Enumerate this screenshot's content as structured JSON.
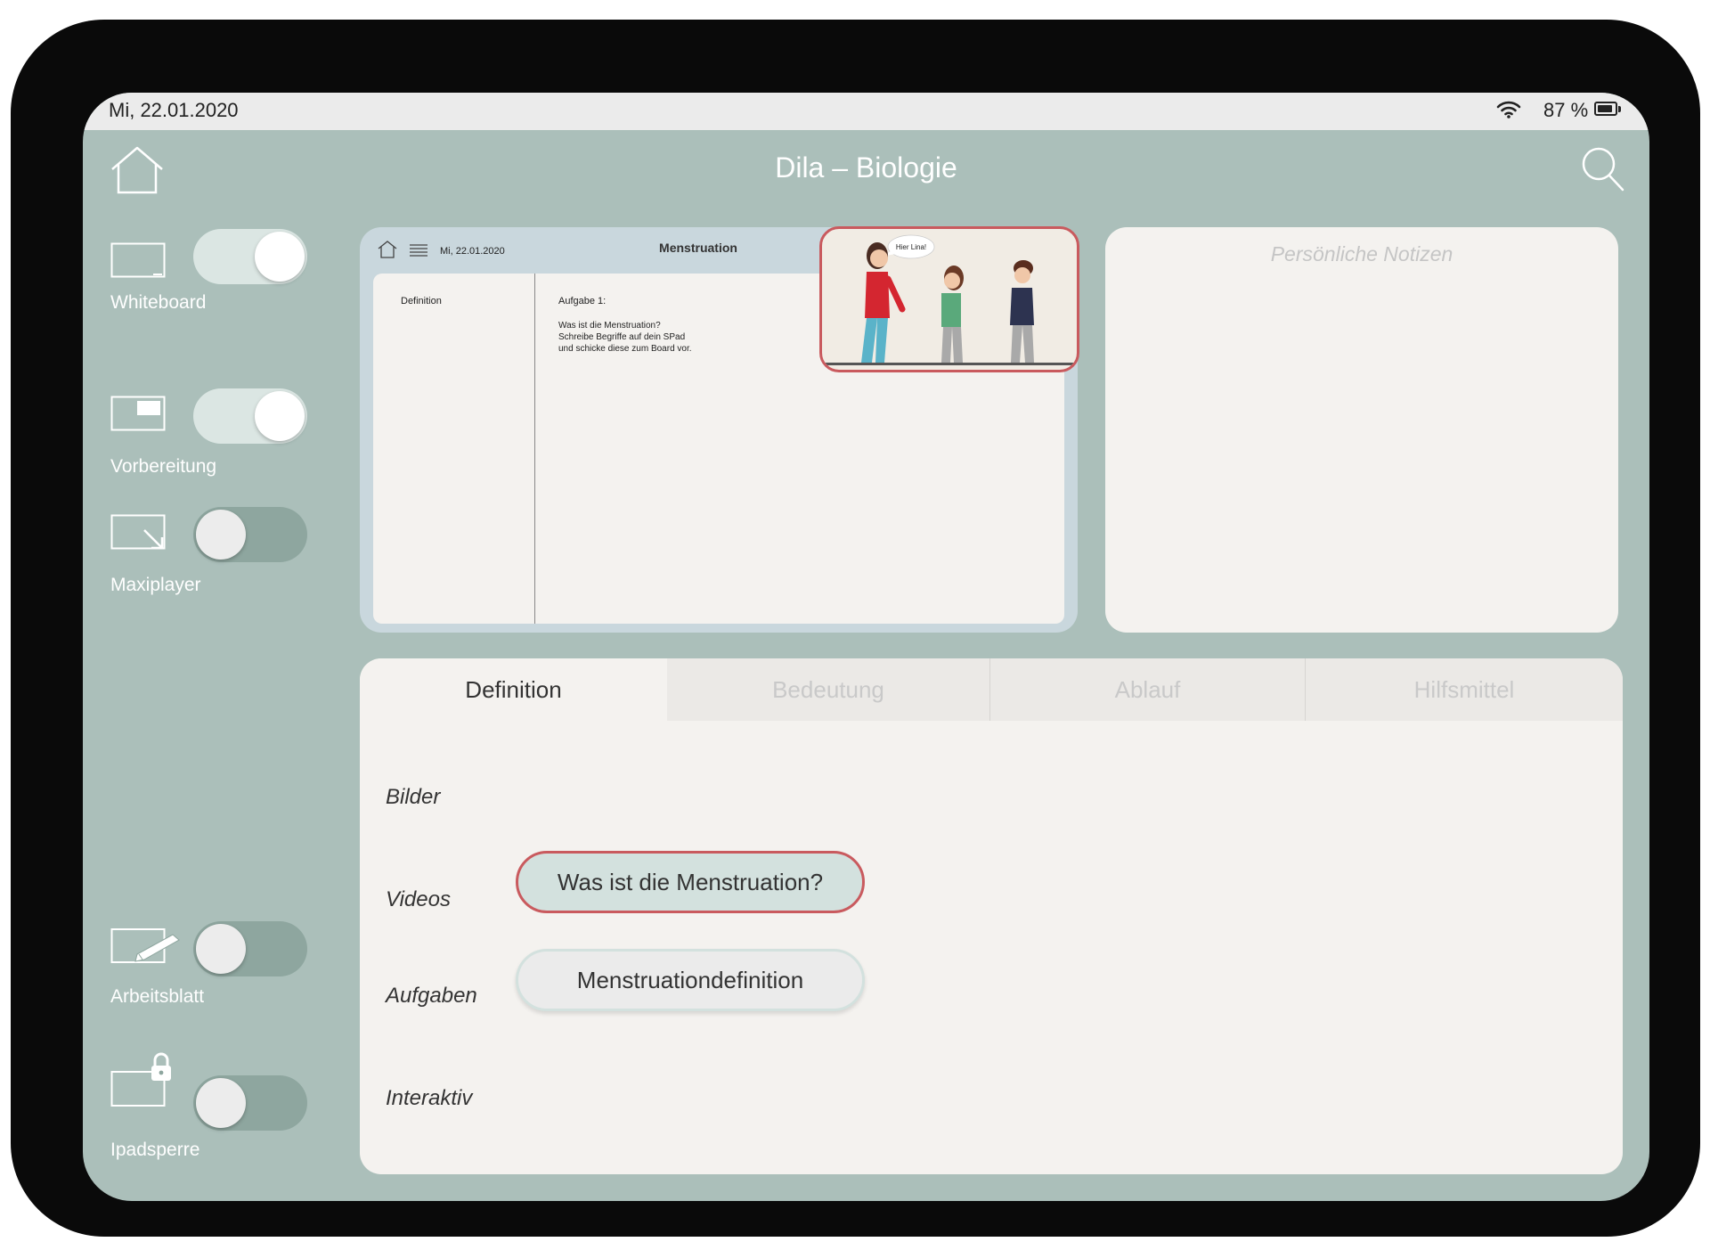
{
  "status_bar": {
    "date": "Mi, 22.01.2020",
    "battery_text": "87 %",
    "battery_level": 0.87
  },
  "header": {
    "title": "Dila – Biologie",
    "home_icon": "home-icon",
    "search_icon": "search-icon"
  },
  "sidebar": {
    "items": [
      {
        "label": "Whiteboard",
        "icon": "whiteboard-icon",
        "on": true
      },
      {
        "label": "Vorbereitung",
        "icon": "preparation-screen-icon",
        "on": true
      },
      {
        "label": "Maxiplayer",
        "icon": "maximize-icon",
        "on": false
      },
      {
        "label": "Arbeitsblatt",
        "icon": "worksheet-pen-icon",
        "on": false
      },
      {
        "label": "Ipadsperre",
        "icon": "ipad-lock-icon",
        "on": false
      }
    ]
  },
  "preview": {
    "date": "Mi, 22.01.2020",
    "title": "Menstruation",
    "sidebar_label": "Definition",
    "task_title": "Aufgabe 1:",
    "task_lines": [
      "Was ist die Menstruation?",
      "Schreibe Begriffe auf dein SPad",
      "und schicke diese zum Board vor."
    ],
    "miniplayer_speech": "Hier Lina!"
  },
  "notes": {
    "placeholder": "Persönliche Notizen"
  },
  "tabs": [
    {
      "label": "Definition",
      "active": true
    },
    {
      "label": "Bedeutung",
      "active": false
    },
    {
      "label": "Ablauf",
      "active": false
    },
    {
      "label": "Hilfsmittel",
      "active": false
    }
  ],
  "content": {
    "bilder_label": "Bilder",
    "videos_label": "Videos",
    "video_button": "Was ist die Menstruation?",
    "aufgaben_label": "Aufgaben",
    "task_button": "Menstruationdefinition",
    "interaktiv_label": "Interaktiv"
  },
  "colors": {
    "screen_bg": "#abbfba",
    "accent_red": "#c95a5e",
    "pill_green": "#d3e1de",
    "panel_bg": "#f4f2ef"
  }
}
